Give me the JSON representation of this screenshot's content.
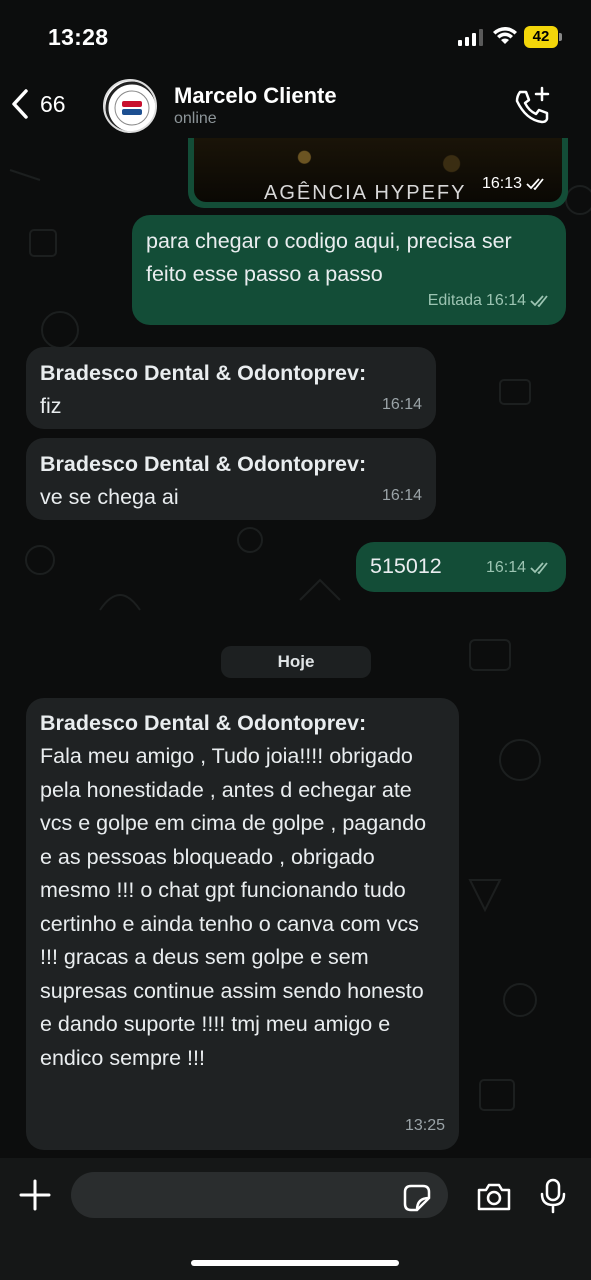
{
  "status_bar": {
    "time": "13:28",
    "battery": "42"
  },
  "header": {
    "back_count": "66",
    "contact_name": "Marcelo Cliente",
    "contact_status": "online"
  },
  "media_message": {
    "brand_text": "AGÊNCIA HYPEFY",
    "time": "16:13"
  },
  "messages": [
    {
      "direction": "out",
      "text": "para chegar o codigo aqui, precisa ser feito esse passo a passo",
      "edited_label": "Editada",
      "time": "16:14"
    },
    {
      "direction": "in",
      "sender": "Bradesco Dental & Odontoprev:",
      "text": "fiz",
      "time": "16:14"
    },
    {
      "direction": "in",
      "sender": "Bradesco Dental & Odontoprev:",
      "text": "ve se chega ai",
      "time": "16:14"
    },
    {
      "direction": "out",
      "text": "515012",
      "time": "16:14"
    },
    {
      "direction": "in",
      "sender": "Bradesco Dental & Odontoprev:",
      "text": "Fala meu amigo , Tudo joia!!!! obrigado pela honestidade , antes d echegar ate vcs e golpe em cima de golpe , pagando e as pessoas bloqueado , obrigado mesmo !!! o chat gpt funcionando tudo certinho e ainda tenho o canva com vcs !!! gracas a deus sem golpe e sem supresas continue assim sendo honesto e dando suporte !!!! tmj meu amigo e endico sempre !!!",
      "time": "13:25"
    }
  ],
  "date_separator": "Hoje",
  "colors": {
    "outgoing": "#134d37",
    "incoming": "#1f2223",
    "battery": "#f3d60a"
  }
}
